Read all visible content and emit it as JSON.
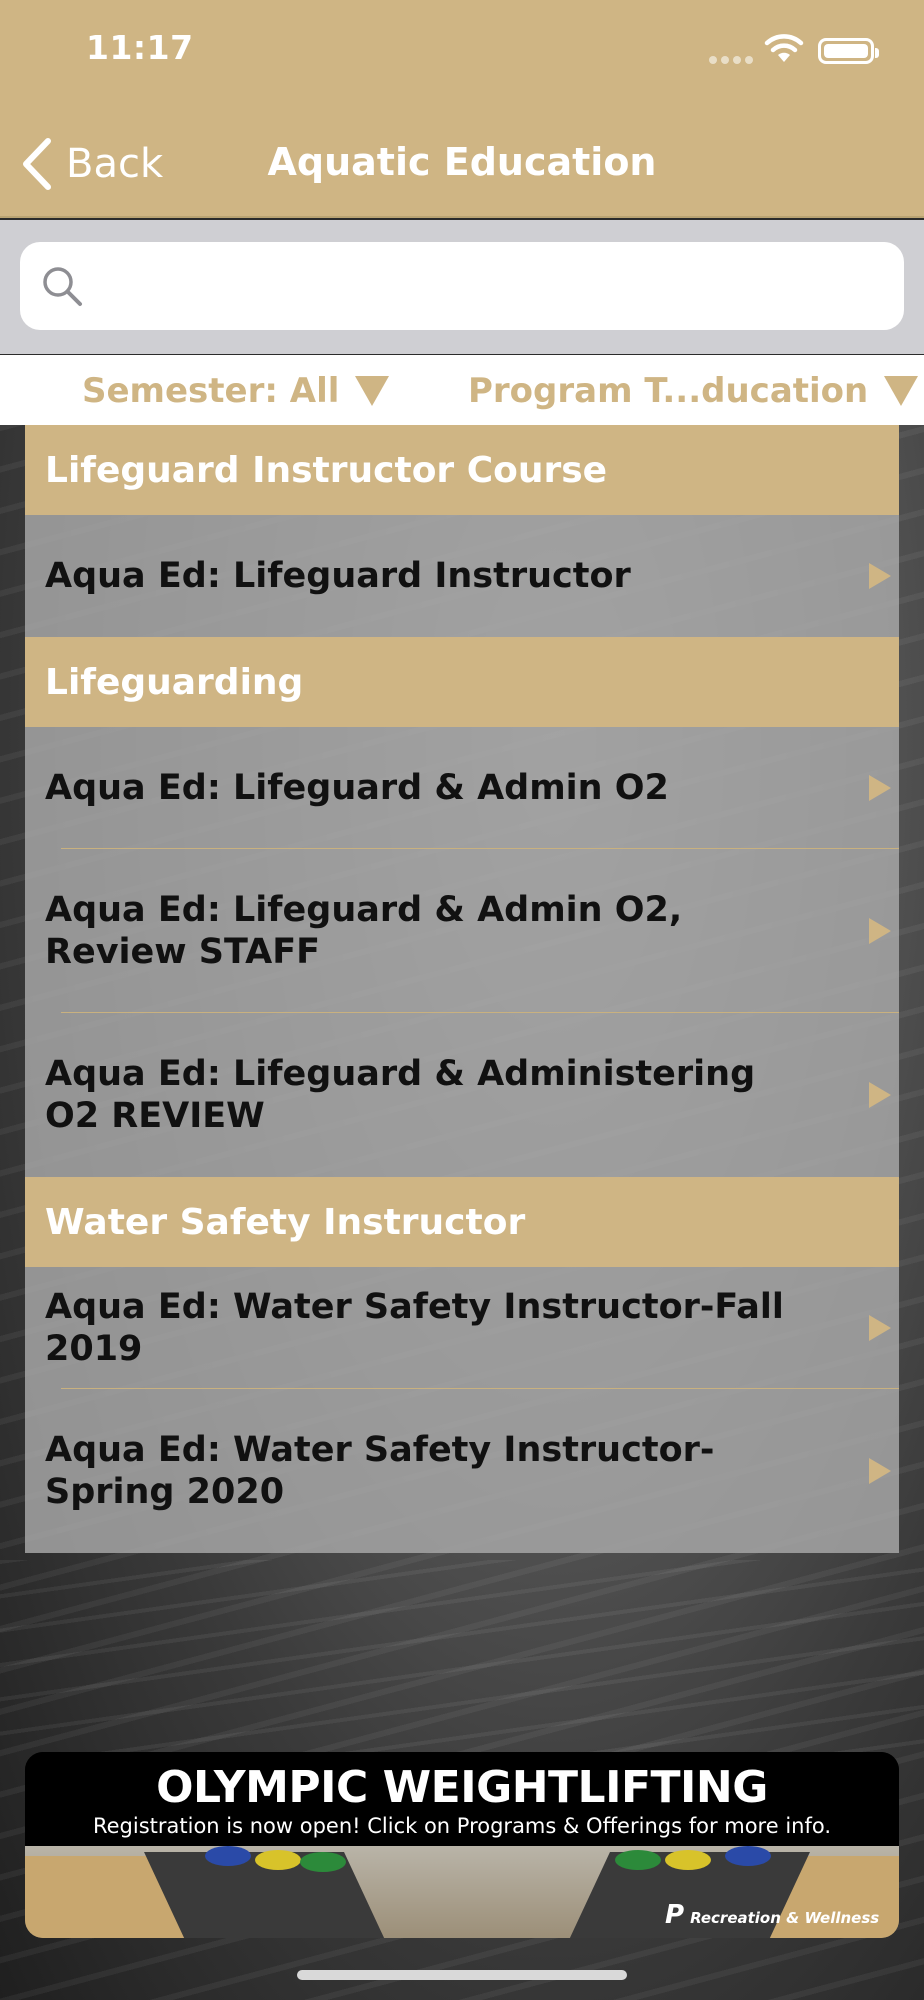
{
  "status_bar": {
    "time": "11:17"
  },
  "nav": {
    "back_label": "Back",
    "title": "Aquatic Education"
  },
  "search": {
    "value": "",
    "placeholder": ""
  },
  "filters": {
    "semester": "Semester: All",
    "program_type": "Program T...ducation"
  },
  "sections": [
    {
      "title": "Lifeguard Instructor Course",
      "items": [
        {
          "label": "Aqua Ed: Lifeguard Instructor"
        }
      ]
    },
    {
      "title": "Lifeguarding",
      "items": [
        {
          "label": "Aqua Ed: Lifeguard & Admin O2"
        },
        {
          "line1": "Aqua Ed: Lifeguard & Admin O2,",
          "line2": "Review STAFF"
        },
        {
          "line1": "Aqua Ed: Lifeguard & Administering",
          "line2": "O2 REVIEW"
        }
      ]
    },
    {
      "title": "Water Safety Instructor",
      "items": [
        {
          "label": "Aqua Ed: Water Safety Instructor-Fall 2019"
        },
        {
          "line1": "Aqua Ed: Water Safety Instructor-",
          "line2": "Spring 2020"
        }
      ]
    }
  ],
  "banner": {
    "title": "OLYMPIC WEIGHTLIFTING",
    "subtitle": "Registration is now open! Click on Programs & Offerings for more info.",
    "logo_text": "Recreation & Wellness"
  },
  "colors": {
    "accent_gold": "#cfb584",
    "row_gray": "#aaaaaa"
  },
  "icons": {
    "back": "chevron-left-icon",
    "search": "search-icon",
    "dropdown": "triangle-down-icon",
    "row_disclosure": "triangle-right-icon"
  }
}
